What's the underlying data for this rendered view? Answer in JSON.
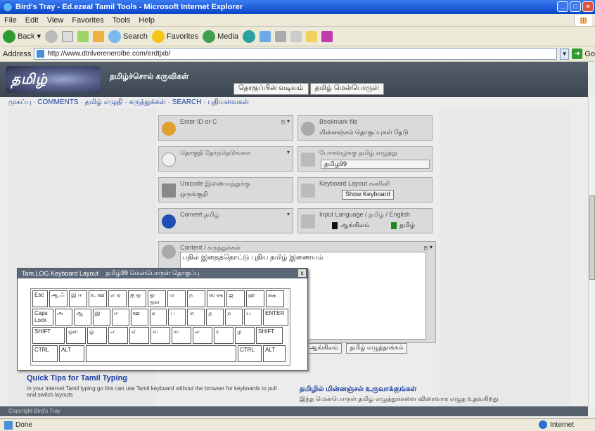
{
  "browser": {
    "title": "Bird's Tray - Ed.ezeal Tamil Tools - Microsoft Internet Explorer",
    "menu": [
      "File",
      "Edit",
      "View",
      "Favorites",
      "Tools",
      "Help"
    ],
    "toolbar": {
      "back": "Back",
      "search": "Search",
      "favorites": "Favorites",
      "media": "Media"
    },
    "address_label": "Address",
    "address_value": "http://www.dtrilverenerolbe.com/erdtjxb/",
    "go": "Go"
  },
  "site": {
    "logo": "தமிழ்",
    "subtitle": "தமிழ்ச்சொல் கருவிகள்",
    "tabs": [
      "தொகுப்பின் வடிவம்",
      "தமிழ் மென்பொருள்"
    ],
    "breadcrumb": "முகப்பு · COMMENTS · தமிழ் எழுதி · கருத்துக்கள் · SEARCH · புதியவைகள்"
  },
  "cards": {
    "c1": {
      "title": "Enter ID or C",
      "dd": "ஐ ▾"
    },
    "c2": {
      "title": "Bookmark file",
      "value": "மின்னஞ்சல் தொகுப்புகள் தேடு"
    },
    "c3": {
      "title": "தொகுதி தேர்ந்தெடுங்கள்",
      "dd": "▾"
    },
    "c4": {
      "title": "பேச்சுவழக்கு தமிழ் எழுத்து",
      "select": "தமிழ்99"
    },
    "c5": {
      "title": "Unicode இணையத்துக்கு",
      "value": "ஒருங்குறி"
    },
    "c6": {
      "title": "Keyboard Layout கணினி",
      "button": "Show Keyboard"
    },
    "c7": {
      "title": "Convert தமிழ்",
      "dd": "▾"
    },
    "c8": {
      "title": "Input Language / தமிழ் / English",
      "opt1": "ஆங்கிலம்",
      "opt2": "தமிழ்"
    }
  },
  "editor": {
    "title": "Content / கருத்துக்கள்",
    "text": "பதில் இதைத்தொட்டு புதிய தமிழ் இணையம்",
    "corner": "ஐ ▾",
    "tabs": [
      "ஆங்கிலம்",
      "தமிழ் எழுத்தாக்கம்"
    ]
  },
  "keyboard": {
    "title": "Tam.LOG Keyboard Layout",
    "subtitle": "தமிழ்99 மென்பொருள் தொகுப்பு",
    "close": "x",
    "row1": [
      "Esc",
      "ஆ ஃ",
      "இ ஈ",
      "உ ஊ",
      "எ ஏ",
      "ஐ ஒ",
      "ஓ ஔ",
      "ம",
      "ந",
      "ஸ ஷ",
      "ஜ",
      "ஹ",
      "க்ஷ"
    ],
    "row2": [
      "Caps Lock",
      "அ",
      "ஆ",
      "இ",
      "ஈ",
      "ஊ",
      "க",
      "ப",
      "ம",
      "த",
      "ந",
      "ய",
      "ENTER"
    ],
    "row3": [
      "SHIFT",
      "ஔ",
      "ஓ",
      "எ",
      "ஏ",
      "வ",
      "ங",
      "ல",
      "ர",
      "ழ",
      "SHIFT"
    ],
    "row4": [
      "CTRL",
      "ALT",
      "",
      "CTRL",
      "ALT"
    ]
  },
  "bottom": {
    "title": "Quick Tips for Tamil Typing",
    "line": "In your internet Tamil typing go this can use Tamil keyboard without the browser for keyboards to pull and switch layouts",
    "rtitle": "தமிழில் மின்னஞ்சல் உருவாக்குங்கள்",
    "rline": "இந்த மென்பொருள் தமிழ் எழுத்துக்களை விரைவாக எழுத உதவுகிறது"
  },
  "footer": "Copyright Bird's Tray",
  "status": {
    "left": "Done",
    "zone": "Internet"
  }
}
